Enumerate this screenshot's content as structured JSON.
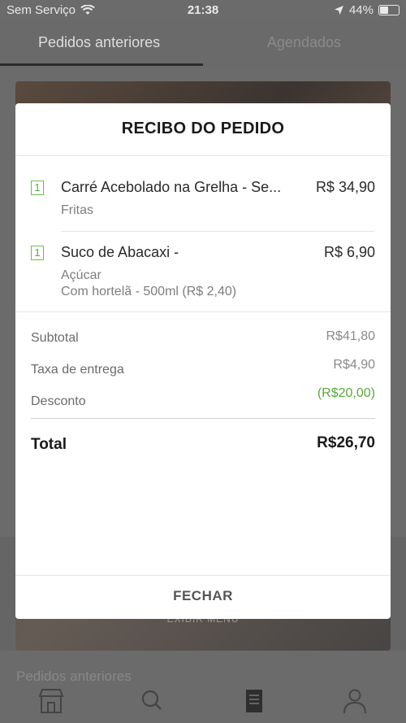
{
  "status_bar": {
    "carrier": "Sem Serviço",
    "time": "21:38",
    "battery": "44%"
  },
  "background": {
    "tabs": [
      "Pedidos anteriores",
      "Agendados"
    ],
    "exibir_menu": "EXIBIR MENU",
    "list_peek": "Pedidos anteriores"
  },
  "modal": {
    "title": "RECIBO DO PEDIDO",
    "items": [
      {
        "qty": "1",
        "name": "Carré Acebolado na Grelha - Se...",
        "price": "R$ 34,90",
        "details": [
          "Fritas"
        ]
      },
      {
        "qty": "1",
        "name": "Suco de Abacaxi -",
        "price": "R$ 6,90",
        "details": [
          "Açúcar",
          "Com hortelã - 500ml (R$ 2,40)"
        ]
      }
    ],
    "summary": {
      "subtotal_label": "Subtotal",
      "subtotal_value": "R$41,80",
      "delivery_label": "Taxa de entrega",
      "delivery_value": "R$4,90",
      "discount_label": "Desconto",
      "discount_value": "(R$20,00)",
      "total_label": "Total",
      "total_value": "R$26,70"
    },
    "close_label": "FECHAR"
  },
  "colors": {
    "accent_green": "#5aa83b",
    "overlay": "#6b6b6b"
  }
}
